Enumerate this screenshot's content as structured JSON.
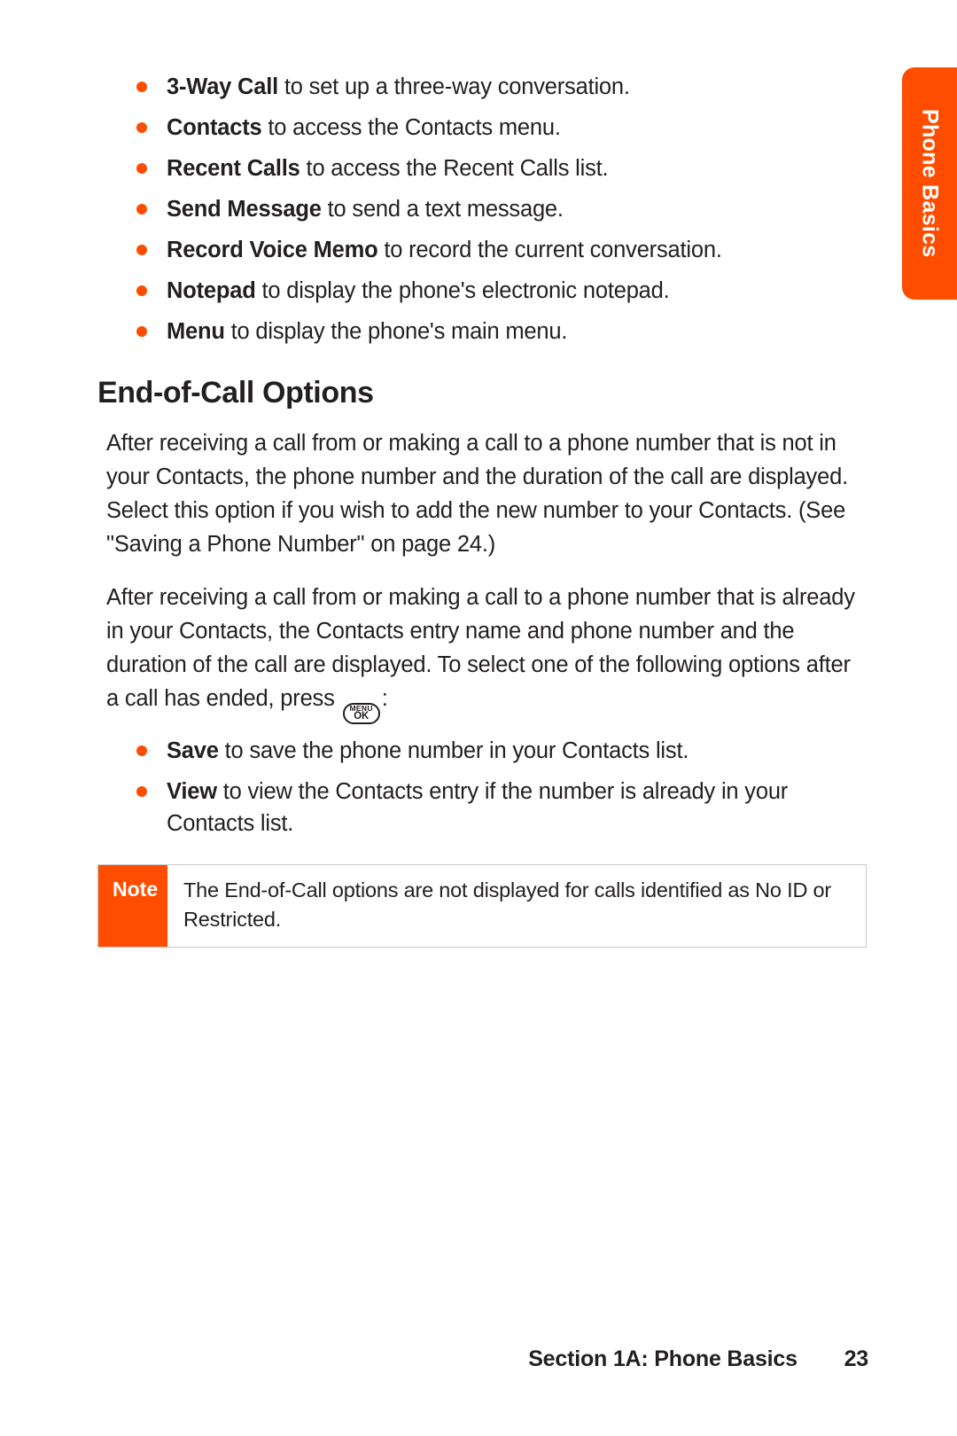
{
  "side_tab": "Phone Basics",
  "top_bullets": [
    {
      "bold": "3-Way Call",
      "rest": " to set up a three-way conversation."
    },
    {
      "bold": "Contacts",
      "rest": " to access the Contacts menu."
    },
    {
      "bold": "Recent Calls",
      "rest": " to access the Recent Calls list."
    },
    {
      "bold": "Send Message",
      "rest": " to send a text message."
    },
    {
      "bold": "Record Voice Memo",
      "rest": " to record the current conversation."
    },
    {
      "bold": "Notepad",
      "rest": " to display the phone's electronic notepad."
    },
    {
      "bold": "Menu",
      "rest": " to display the phone's main menu."
    }
  ],
  "heading": "End-of-Call Options",
  "para1": "After receiving a call from or making a call to a phone number that is not in your Contacts, the phone number and the duration of the call are displayed. Select this option if you wish to add the new number to your Contacts. (See \"Saving a Phone Number\" on page 24.)",
  "para2_pre": "After receiving a call from or making a call to a phone number that is already in your Contacts, the Contacts entry name and phone number and the duration of the call are displayed. To select one of the following options after a call has ended, press ",
  "menu_key": {
    "top": "MENU",
    "bottom": "OK"
  },
  "para2_post": ":",
  "end_bullets": [
    {
      "bold": "Save",
      "rest": " to save the phone number in your Contacts list."
    },
    {
      "bold": "View",
      "rest": " to view the Contacts entry if the number is already in your Contacts list."
    }
  ],
  "note": {
    "label": "Note",
    "text": "The End-of-Call options are not displayed for calls identified as No ID or Restricted."
  },
  "footer": {
    "section": "Section 1A: Phone Basics",
    "page": "23"
  }
}
